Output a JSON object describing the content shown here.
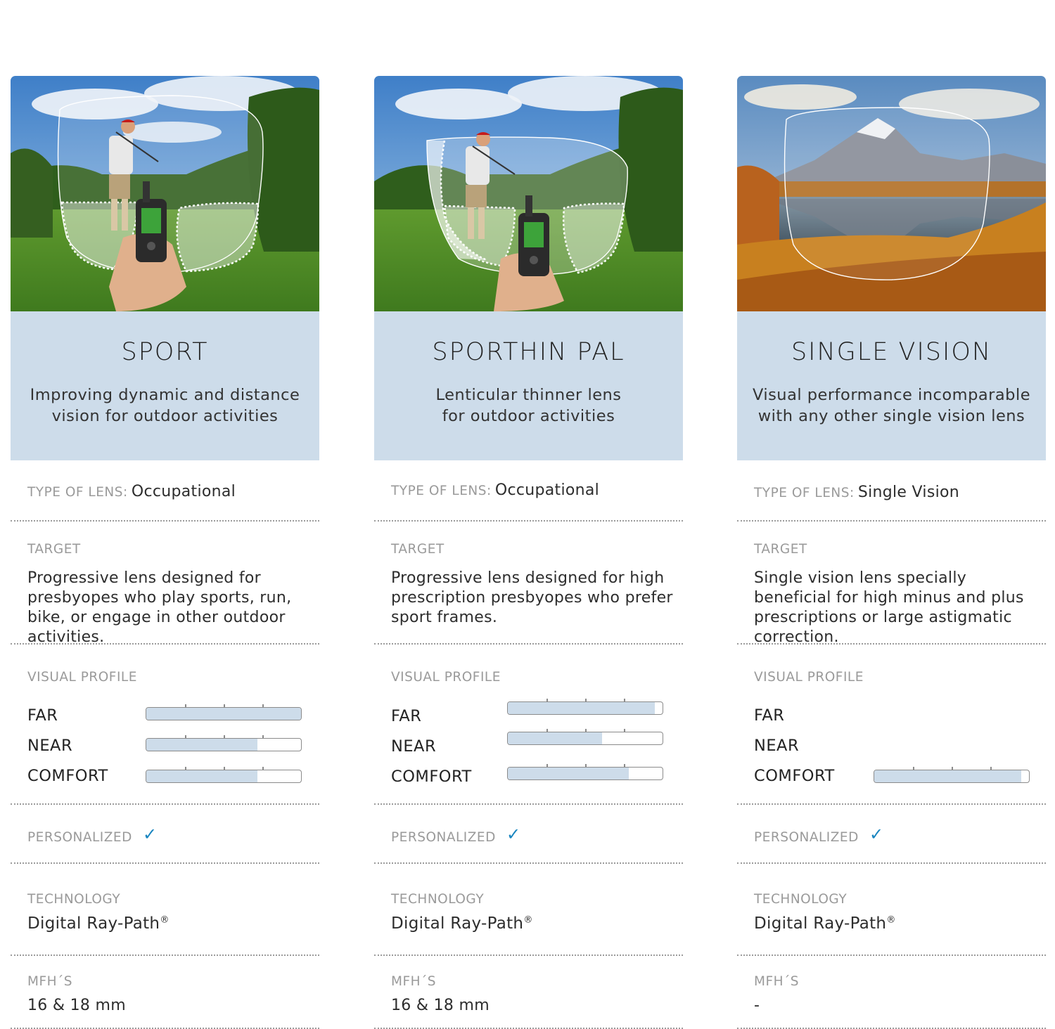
{
  "cards": [
    {
      "title": "SPORT",
      "subtitle_line1": "Improving dynamic and distance",
      "subtitle_line2": "vision for outdoor activities",
      "type_label": "TYPE OF LENS:",
      "type_value": "Occupational",
      "target_label": "TARGET",
      "target_text": "Progressive lens designed for presbyopes who play sports, run, bike, or engage in other outdoor activities.",
      "visual_label": "VISUAL PROFILE",
      "profile": [
        {
          "name": "FAR",
          "level": 1.0
        },
        {
          "name": "NEAR",
          "level": 0.72
        },
        {
          "name": "COMFORT",
          "level": 0.72
        }
      ],
      "personalized_label": "PERSONALIZED",
      "personalized_mark": "✓",
      "tech_label": "TECHNOLOGY",
      "tech_value": "Digital Ray-Path",
      "tech_mark": "®",
      "mfh_label": "MFH´S",
      "mfh_value": "16 & 18 mm",
      "photo": "golfer-gps"
    },
    {
      "title": "SPORTHIN PAL",
      "subtitle_line1": "Lenticular thinner lens",
      "subtitle_line2": "for outdoor activities",
      "type_label": "TYPE OF LENS:",
      "type_value": "Occupational",
      "target_label": "TARGET",
      "target_text": "Progressive lens designed for high prescription presbyopes who prefer sport frames.",
      "visual_label": "VISUAL PROFILE",
      "profile": [
        {
          "name": "FAR",
          "level": 0.95
        },
        {
          "name": "NEAR",
          "level": 0.61
        },
        {
          "name": "COMFORT",
          "level": 0.78
        }
      ],
      "personalized_label": "PERSONALIZED",
      "personalized_mark": "✓",
      "tech_label": "TECHNOLOGY",
      "tech_value": "Digital Ray-Path",
      "tech_mark": "®",
      "mfh_label": "MFH´S",
      "mfh_value": "16 & 18 mm",
      "photo": "golfer-gps"
    },
    {
      "title": "SINGLE VISION",
      "subtitle_line1": "Visual performance incomparable",
      "subtitle_line2": "with any other single vision lens",
      "type_label": "TYPE OF LENS:",
      "type_value": "Single Vision",
      "target_label": "TARGET",
      "target_text": "Single vision lens specially beneficial for high minus and plus prescriptions or large astigmatic correction.",
      "visual_label": "VISUAL PROFILE",
      "profile": [
        {
          "name": "FAR",
          "level": null
        },
        {
          "name": "NEAR",
          "level": null
        },
        {
          "name": "COMFORT",
          "level": 0.95
        }
      ],
      "personalized_label": "PERSONALIZED",
      "personalized_mark": "✓",
      "tech_label": "TECHNOLOGY",
      "tech_value": "Digital Ray-Path",
      "tech_mark": "®",
      "mfh_label": "MFH´S",
      "mfh_value": "-",
      "photo": "mountain-lake"
    }
  ],
  "colors": {
    "header_bg": "#cddcea",
    "bar_fill": "#cddcea",
    "check": "#1a86c0",
    "label": "#9a9a9a"
  }
}
